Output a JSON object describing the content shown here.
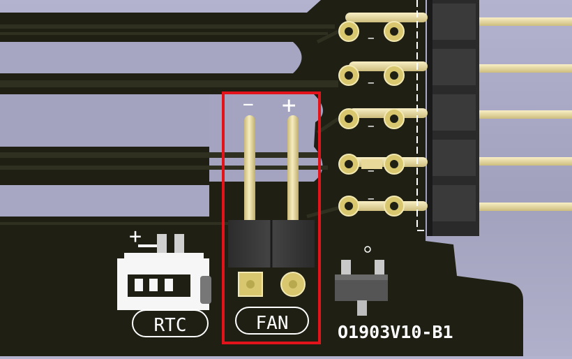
{
  "viewer": {
    "colors": {
      "background": "#a9a9c6",
      "board": "#1f2013",
      "trace": "#2c2d1f",
      "silkscreen": "#ffffff",
      "pin_gold": "#eedfa2",
      "pad_gold": "#d8c76f",
      "header_body": "#3b3b3b",
      "highlight": "#e3131b"
    }
  },
  "pcb": {
    "board_label": "O1903V10-B1",
    "fan_connector": {
      "label": "FAN",
      "minus_marker": "−",
      "plus_marker": "+",
      "icon": "pin-header-icon"
    },
    "rtc_connector": {
      "label": "RTC",
      "plus_marker": "+",
      "icon": "jst-connector-icon"
    },
    "right_header": {
      "row_markers": [
        "−",
        "−",
        "−",
        "−",
        "−"
      ]
    },
    "transistor": {
      "icon": "sot23-transistor-icon"
    }
  }
}
